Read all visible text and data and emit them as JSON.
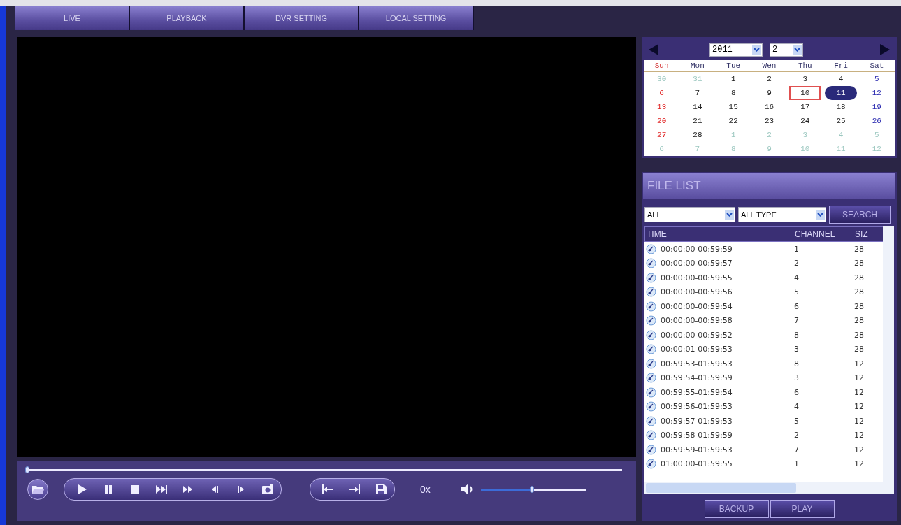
{
  "tabs": [
    {
      "label": "LIVE",
      "selected": false
    },
    {
      "label": "PLAYBACK",
      "selected": false
    },
    {
      "label": "DVR SETTING",
      "selected": false
    },
    {
      "label": "LOCAL SETTING",
      "selected": false
    }
  ],
  "player": {
    "progress": {
      "level": 0.0
    },
    "speed": "0x",
    "volume": {
      "level": 0.49
    }
  },
  "calendar": {
    "year": "2011",
    "month": "2",
    "weekdays": [
      "Sun",
      "Mon",
      "Tue",
      "Wen",
      "Thu",
      "Fri",
      "Sat"
    ],
    "weeks": [
      [
        {
          "day": "30",
          "other_month": true,
          "selected": false,
          "today": false
        },
        {
          "day": "31",
          "other_month": true,
          "selected": false,
          "today": false
        },
        {
          "day": "1",
          "other_month": false,
          "selected": false,
          "today": false
        },
        {
          "day": "2",
          "other_month": false,
          "selected": false,
          "today": false
        },
        {
          "day": "3",
          "other_month": false,
          "selected": false,
          "today": false
        },
        {
          "day": "4",
          "other_month": false,
          "selected": false,
          "today": false
        },
        {
          "day": "5",
          "other_month": false,
          "selected": false,
          "today": false
        }
      ],
      [
        {
          "day": "6",
          "other_month": false,
          "selected": false,
          "today": false
        },
        {
          "day": "7",
          "other_month": false,
          "selected": false,
          "today": false
        },
        {
          "day": "8",
          "other_month": false,
          "selected": false,
          "today": false
        },
        {
          "day": "9",
          "other_month": false,
          "selected": false,
          "today": false
        },
        {
          "day": "10",
          "other_month": false,
          "selected": false,
          "today": true
        },
        {
          "day": "11",
          "other_month": false,
          "selected": true,
          "today": false
        },
        {
          "day": "12",
          "other_month": false,
          "selected": false,
          "today": false
        }
      ],
      [
        {
          "day": "13",
          "other_month": false,
          "selected": false,
          "today": false
        },
        {
          "day": "14",
          "other_month": false,
          "selected": false,
          "today": false
        },
        {
          "day": "15",
          "other_month": false,
          "selected": false,
          "today": false
        },
        {
          "day": "16",
          "other_month": false,
          "selected": false,
          "today": false
        },
        {
          "day": "17",
          "other_month": false,
          "selected": false,
          "today": false
        },
        {
          "day": "18",
          "other_month": false,
          "selected": false,
          "today": false
        },
        {
          "day": "19",
          "other_month": false,
          "selected": false,
          "today": false
        }
      ],
      [
        {
          "day": "20",
          "other_month": false,
          "selected": false,
          "today": false
        },
        {
          "day": "21",
          "other_month": false,
          "selected": false,
          "today": false
        },
        {
          "day": "22",
          "other_month": false,
          "selected": false,
          "today": false
        },
        {
          "day": "23",
          "other_month": false,
          "selected": false,
          "today": false
        },
        {
          "day": "24",
          "other_month": false,
          "selected": false,
          "today": false
        },
        {
          "day": "25",
          "other_month": false,
          "selected": false,
          "today": false
        },
        {
          "day": "26",
          "other_month": false,
          "selected": false,
          "today": false
        }
      ],
      [
        {
          "day": "27",
          "other_month": false,
          "selected": false,
          "today": false
        },
        {
          "day": "28",
          "other_month": false,
          "selected": false,
          "today": false
        },
        {
          "day": "1",
          "other_month": true,
          "selected": false,
          "today": false
        },
        {
          "day": "2",
          "other_month": true,
          "selected": false,
          "today": false
        },
        {
          "day": "3",
          "other_month": true,
          "selected": false,
          "today": false
        },
        {
          "day": "4",
          "other_month": true,
          "selected": false,
          "today": false
        },
        {
          "day": "5",
          "other_month": true,
          "selected": false,
          "today": false
        }
      ],
      [
        {
          "day": "6",
          "other_month": true,
          "selected": false,
          "today": false
        },
        {
          "day": "7",
          "other_month": true,
          "selected": false,
          "today": false
        },
        {
          "day": "8",
          "other_month": true,
          "selected": false,
          "today": false
        },
        {
          "day": "9",
          "other_month": true,
          "selected": false,
          "today": false
        },
        {
          "day": "10",
          "other_month": true,
          "selected": false,
          "today": false
        },
        {
          "day": "11",
          "other_month": true,
          "selected": false,
          "today": false
        },
        {
          "day": "12",
          "other_month": true,
          "selected": false,
          "today": false
        }
      ]
    ]
  },
  "file_list": {
    "title": "FILE LIST",
    "channel_filter": "ALL",
    "type_filter": "ALL TYPE",
    "search_button": "SEARCH",
    "columns": [
      "TIME",
      "CHANNEL",
      "SIZ"
    ],
    "rows": [
      {
        "time": "00:00:00-00:59:59",
        "channel": "1",
        "size": "28"
      },
      {
        "time": "00:00:00-00:59:57",
        "channel": "2",
        "size": "28"
      },
      {
        "time": "00:00:00-00:59:55",
        "channel": "4",
        "size": "28"
      },
      {
        "time": "00:00:00-00:59:56",
        "channel": "5",
        "size": "28"
      },
      {
        "time": "00:00:00-00:59:54",
        "channel": "6",
        "size": "28"
      },
      {
        "time": "00:00:00-00:59:58",
        "channel": "7",
        "size": "28"
      },
      {
        "time": "00:00:00-00:59:52",
        "channel": "8",
        "size": "28"
      },
      {
        "time": "00:00:01-00:59:53",
        "channel": "3",
        "size": "28"
      },
      {
        "time": "00:59:53-01:59:53",
        "channel": "8",
        "size": "12"
      },
      {
        "time": "00:59:54-01:59:59",
        "channel": "3",
        "size": "12"
      },
      {
        "time": "00:59:55-01:59:54",
        "channel": "6",
        "size": "12"
      },
      {
        "time": "00:59:56-01:59:53",
        "channel": "4",
        "size": "12"
      },
      {
        "time": "00:59:57-01:59:53",
        "channel": "5",
        "size": "12"
      },
      {
        "time": "00:59:58-01:59:59",
        "channel": "2",
        "size": "12"
      },
      {
        "time": "00:59:59-01:59:53",
        "channel": "7",
        "size": "12"
      },
      {
        "time": "01:00:00-01:59:55",
        "channel": "1",
        "size": "12"
      }
    ],
    "buttons": [
      "BACKUP",
      "PLAY"
    ]
  }
}
